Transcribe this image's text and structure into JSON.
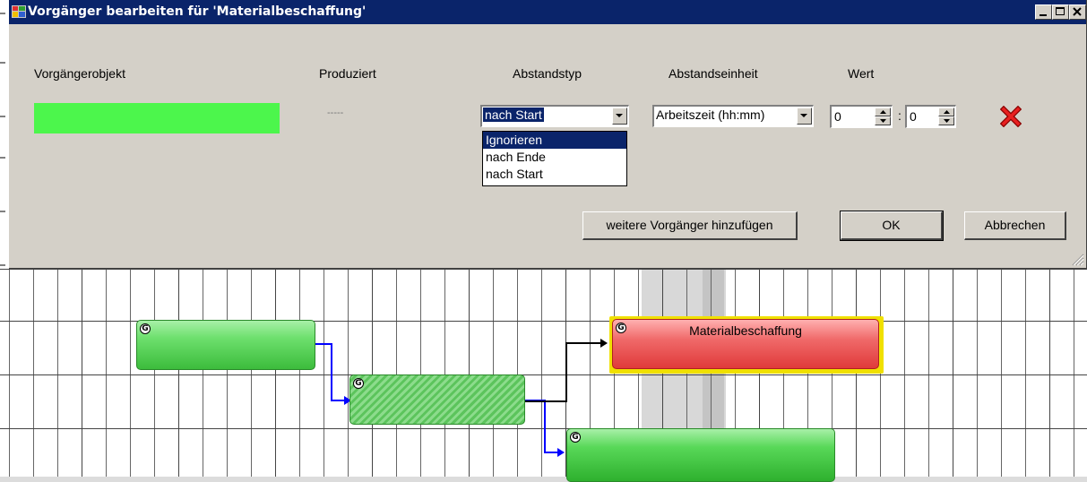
{
  "dialog": {
    "title": "Vorgänger bearbeiten für 'Materialbeschaffung'",
    "columns": {
      "predecessor": "Vorgängerobjekt",
      "produced": "Produziert",
      "gap_type": "Abstandstyp",
      "gap_unit": "Abstandseinheit",
      "value": "Wert"
    },
    "row": {
      "predecessor_color": "#4cf64c",
      "produced": "-----",
      "gap_type": "nach Start",
      "gap_unit": "Arbeitszeit (hh:mm)",
      "hours": "0",
      "minutes": "0",
      "separator": ":"
    },
    "gap_type_options": [
      "Ignorieren",
      "nach Ende",
      "nach Start"
    ],
    "gap_type_highlighted": "Ignorieren",
    "buttons": {
      "add_more": "weitere Vorgänger hinzufügen",
      "ok": "OK",
      "cancel": "Abbrechen"
    }
  },
  "gantt": {
    "bars": [
      {
        "id": "bar-1",
        "badge": "G",
        "label": "",
        "color": "#4ccc4c"
      },
      {
        "id": "bar-2",
        "badge": "G",
        "label": "",
        "color": "#4ccc4c",
        "hatched": true
      },
      {
        "id": "bar-3",
        "badge": "G",
        "label": "Materialbeschaffung",
        "color": "#f04848",
        "selected": true
      },
      {
        "id": "bar-4",
        "badge": "G",
        "label": "",
        "color": "#44cc44"
      }
    ]
  },
  "colors": {
    "titlebar": "#0a246a",
    "dialog_bg": "#d4d0c8",
    "selection": "#0a246a",
    "link_blue": "#0000ff",
    "link_black": "#000000",
    "selected_outline": "#f0e000"
  }
}
